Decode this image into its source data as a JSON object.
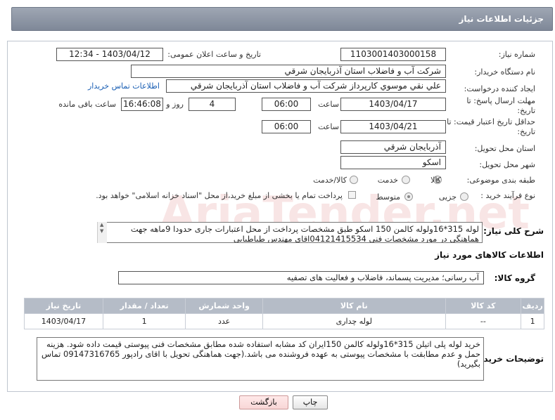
{
  "header": {
    "title": "جزئیات اطلاعات نیاز"
  },
  "fields": {
    "need_number_label": "شماره نیاز:",
    "need_number": "1103001403000158",
    "announce_label": "تاریخ و ساعت اعلان عمومی:",
    "announce_value": "1403/04/12 - 12:34",
    "buyer_org_label": "نام دستگاه خریدار:",
    "buyer_org": "شرکت آب و فاضلاب استان آذربایجان شرقي",
    "creator_label": "ایجاد کننده درخواست:",
    "creator": "علي نقي موسوي کارپرداز شرکت آب و فاضلاب استان آذربایجان شرقي",
    "contact_link": "اطلاعات تماس خریدار",
    "reply_deadline_label_1": "مهلت ارسال پاسخ: تا",
    "reply_deadline_label_2": "تاریخ:",
    "reply_date": "1403/04/17",
    "time_label": "ساعت",
    "reply_time": "06:00",
    "days_remaining": "4",
    "day_label": "روز و",
    "time_remaining": "16:46:08",
    "remaining_label": "ساعت باقی مانده",
    "price_validity_label_1": "حداقل تاریخ اعتبار قیمت: تا",
    "price_validity_label_2": "تاریخ:",
    "price_date": "1403/04/21",
    "price_time": "06:00",
    "province_label": "استان محل تحویل:",
    "province": "آذربایجان شرقي",
    "city_label": "شهر محل تحویل:",
    "city": "اسکو",
    "category_label": "طبقه بندی موضوعی:",
    "category_options": [
      "کالا",
      "خدمت",
      "کالا/خدمت"
    ],
    "process_label": "نوع فرآیند خرید :",
    "process_options": [
      "جزیی",
      "متوسط"
    ],
    "payment_note": "پرداخت تمام یا بخشی از مبلغ خرید،از محل \"اسناد خزانه اسلامی\" خواهد بود."
  },
  "description": {
    "label": "شرح کلی نیاز:",
    "text": "لوله 315*16ولوله  کالمن 150 اسکو طبق مشخصات پرداخت از محل اعتبارات جاری حدودا 9ماهه جهت هماهنگی در مورد مشخصات فنی 04121415534اقای مهندس طباطبایی"
  },
  "goods_section": {
    "title": "اطلاعات کالاهای مورد نیاز",
    "group_label": "گروه کالا:",
    "group_value": "آب رسانی؛ مدیریت پسماند، فاضلاب و فعالیت های تصفیه"
  },
  "table": {
    "headers": [
      "ردیف",
      "کد کالا",
      "نام کالا",
      "واحد شمارش",
      "تعداد / مقدار",
      "تاریخ نیاز"
    ],
    "rows": [
      [
        "1",
        "--",
        "لوله چداری",
        "عدد",
        "1",
        "1403/04/17"
      ]
    ]
  },
  "buyer_notes": {
    "label": "توضیحات خریدار:",
    "text": "خرید لوله پلی اتیلن 315*16ولوله کالمن 150ایران کد مشابه استفاده شده مطابق مشخصات فنی پیوستی قیمت داده شود. هزینه حمل و عدم مطابقت با مشخصات پیوستی به عهده فروشنده می باشد.(جهت هماهنگی تحویل با اقای رادپور 09147316765 تماس بگیرید)"
  },
  "buttons": {
    "print": "چاپ",
    "back": "بازگشت"
  },
  "watermark": {
    "text": "AriaTender.net"
  },
  "colors": {
    "header": "#8a93a2",
    "table_header": "#b5bcc7",
    "link": "#1a5fb4"
  }
}
